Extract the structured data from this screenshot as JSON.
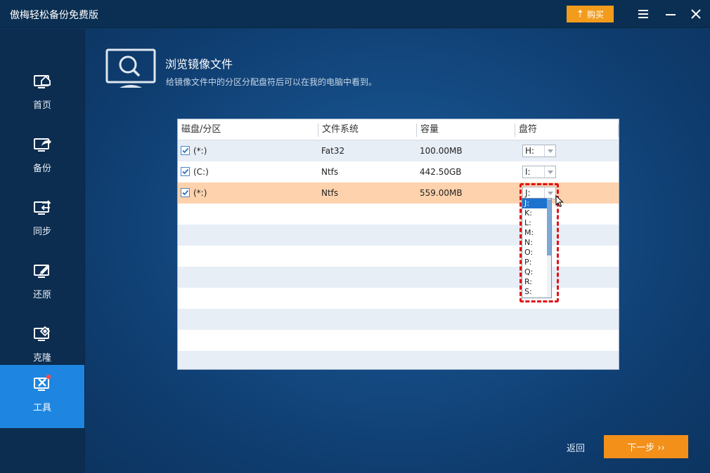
{
  "app": {
    "title": "傲梅轻松备份免费版",
    "buy_label": "购买"
  },
  "sidebar": {
    "items": [
      {
        "label": "首页",
        "icon": "home-monitor-icon"
      },
      {
        "label": "备份",
        "icon": "backup-monitor-icon"
      },
      {
        "label": "同步",
        "icon": "sync-monitor-icon"
      },
      {
        "label": "还原",
        "icon": "restore-monitor-icon"
      },
      {
        "label": "克隆",
        "icon": "clone-monitor-icon"
      },
      {
        "label": "工具",
        "icon": "tools-monitor-icon",
        "active": true
      }
    ]
  },
  "page": {
    "title": "浏览镜像文件",
    "subtitle": "给镜像文件中的分区分配盘符后可以在我的电脑中看到。"
  },
  "table": {
    "columns": [
      "磁盘/分区",
      "文件系统",
      "容量",
      "盘符"
    ],
    "rows": [
      {
        "partition": "(*:)",
        "fs": "Fat32",
        "capacity": "100.00MB",
        "letter": "H:",
        "checked": true
      },
      {
        "partition": "(C:)",
        "fs": "Ntfs",
        "capacity": "442.50GB",
        "letter": "I:",
        "checked": true
      },
      {
        "partition": "(*:)",
        "fs": "Ntfs",
        "capacity": "559.00MB",
        "letter": "J:",
        "checked": true,
        "selected": true
      }
    ]
  },
  "dropdown": {
    "selected": "J:",
    "options": [
      "J:",
      "K:",
      "L:",
      "M:",
      "N:",
      "O:",
      "P:",
      "Q:",
      "R:",
      "S:"
    ]
  },
  "footer": {
    "back_label": "返回",
    "next_label": "下一步 ››"
  },
  "colors": {
    "accent_orange": "#f3901a",
    "active_nav": "#1e86e0",
    "selected_row": "#fdd2ad",
    "highlight_red": "#e0121a"
  }
}
